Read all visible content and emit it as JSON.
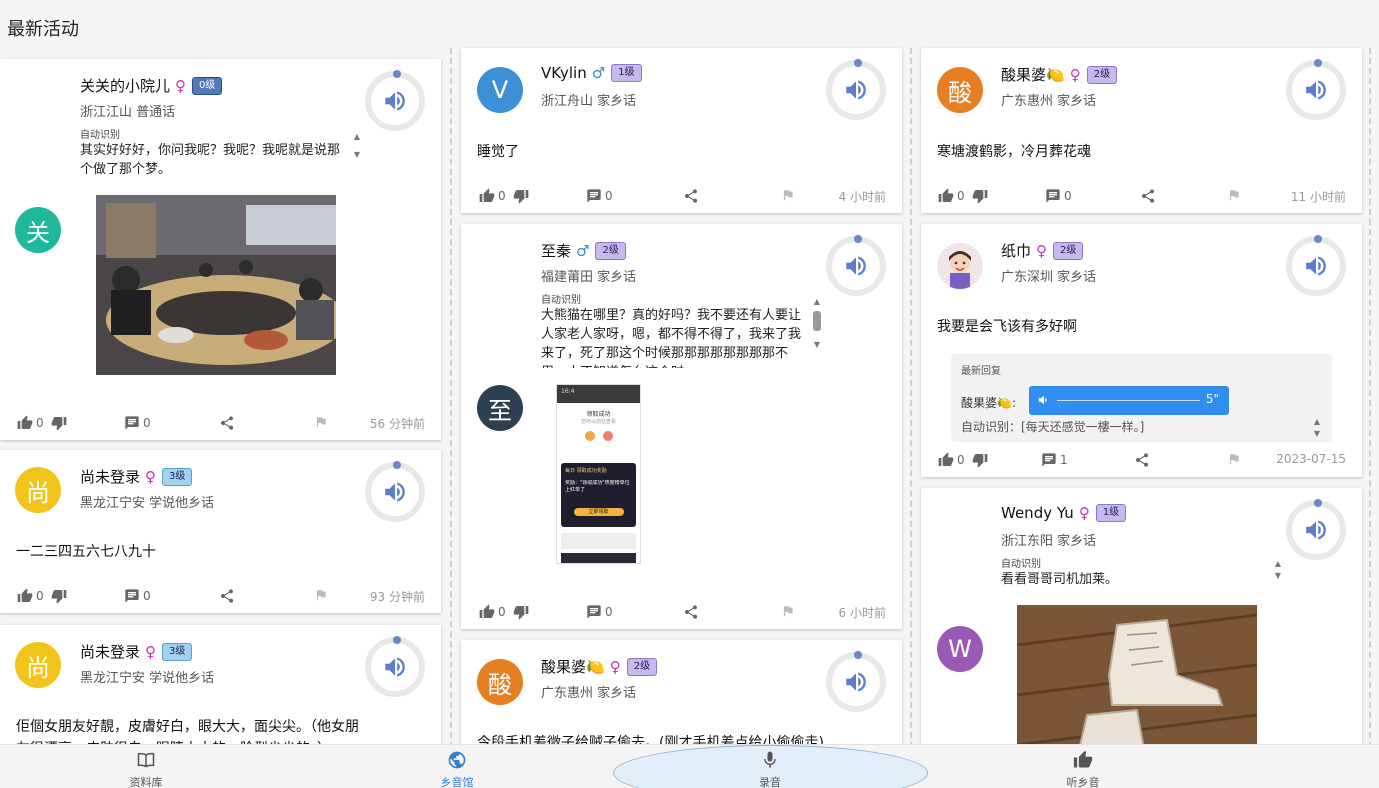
{
  "page_title": "最新活动",
  "col1": [
    {
      "avatar_char": "关",
      "avatar_color": "#1fb89a",
      "name": "关关的小院儿",
      "gender": "♀",
      "level": "0级",
      "location": "浙江江山 普通话",
      "auto_label": "自动识别",
      "transcript": "其实好好好，你问我呢？我呢？我呢就是说那个做了那个梦。",
      "likes": "0",
      "comments": "0",
      "time": "56 分钟前"
    },
    {
      "avatar_char": "尚",
      "avatar_color": "#f0c419",
      "name": "尚未登录",
      "gender": "♀",
      "level": "3级",
      "location": "黑龙江宁安 学说他乡话",
      "text": "一二三四五六七八九十",
      "likes": "0",
      "comments": "0",
      "time": "93 分钟前"
    },
    {
      "avatar_char": "尚",
      "avatar_color": "#f0c419",
      "name": "尚未登录",
      "gender": "♀",
      "level": "3级",
      "location": "黑龙江宁安 学说他乡话",
      "text": "佢個女朋友好靚，皮膚好白，眼大大，面尖尖。（他女朋",
      "text2": "友很漂亮，皮肤很白，眼睛大大的，脸型尖尖的。）"
    }
  ],
  "col2": [
    {
      "avatar_char": "V",
      "avatar_color": "#3d8fd6",
      "name": "VKylin",
      "gender": "♂",
      "level": "1级",
      "location": "浙江舟山 家乡话",
      "text": "睡觉了",
      "likes": "0",
      "comments": "0",
      "time": "4 小时前"
    },
    {
      "avatar_char": "至",
      "avatar_color": "#2c3e50",
      "name": "至秦",
      "gender": "♂",
      "level": "2级",
      "location": "福建莆田 家乡话",
      "auto_label": "自动识别",
      "transcript": "大熊猫在哪里？真的好吗？我不要还有人要让人家老人家呀，嗯，都不得不得了，我来了我来了，死了那这个时候那那那那那那那那不用，小不知道怎么这个时",
      "likes": "0",
      "comments": "0",
      "time": "6 小时前",
      "phone_title": "领取成功",
      "phone_sub": "您可以前往查看",
      "phone_banner": "每日 领取成功奖励",
      "phone_card_title": "奖励：\"领取成功\"热度榜单位上红单了",
      "phone_btn": "立即领取"
    },
    {
      "avatar_char": "酸",
      "avatar_color": "#e67e22",
      "name": "酸果婆",
      "emoji": "🍋",
      "gender": "♀",
      "level": "2级",
      "location": "广东惠州 家乡话",
      "text": "今段手机差微子给贼子偷去。(刚才手机差点给小偷偷走)"
    }
  ],
  "col3": [
    {
      "avatar_char": "酸",
      "avatar_color": "#e67e22",
      "name": "酸果婆",
      "emoji": "🍋",
      "gender": "♀",
      "level": "2级",
      "location": "广东惠州 家乡话",
      "text": "寒塘渡鹤影，冷月葬花魂",
      "likes": "0",
      "comments": "0",
      "time": "11 小时前"
    },
    {
      "name": "纸巾",
      "gender": "♀",
      "level": "2级",
      "location": "广东深圳 家乡话",
      "text": "我要是会飞该有多好啊",
      "reply_title": "最新回复",
      "reply_user": "酸果婆🍋:",
      "reply_duration": "5\"",
      "reply_text": "自动识别：[每天还感觉一樓一样。]",
      "likes": "0",
      "comments": "1",
      "time": "2023-07-15"
    },
    {
      "avatar_char": "W",
      "avatar_color": "#9b59b6",
      "name": "Wendy Yu",
      "gender": "♀",
      "level": "1级",
      "location": "浙江东阳 家乡话",
      "auto_label": "自动识别",
      "transcript": "看看哥哥司机加莱。"
    }
  ],
  "nav": [
    {
      "label": "资料库",
      "icon": "book-icon"
    },
    {
      "label": "乡音馆",
      "icon": "globe-icon",
      "active": true
    },
    {
      "label": "录音",
      "icon": "mic-icon"
    },
    {
      "label": "听乡音",
      "icon": "thumb-up-icon"
    }
  ]
}
